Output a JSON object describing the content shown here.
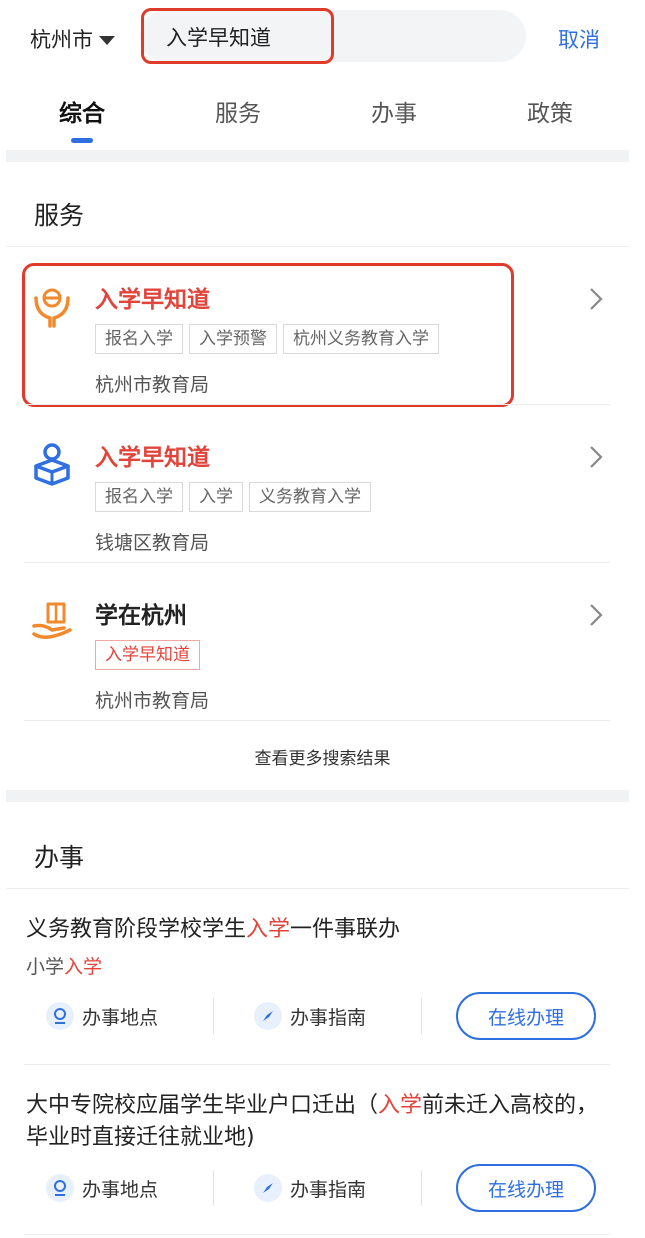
{
  "header": {
    "city": "杭州市",
    "search_query": "入学早知道",
    "cancel": "取消"
  },
  "tabs": [
    {
      "label": "综合",
      "active": true
    },
    {
      "label": "服务",
      "active": false
    },
    {
      "label": "办事",
      "active": false
    },
    {
      "label": "政策",
      "active": false
    }
  ],
  "services": {
    "heading": "服务",
    "items": [
      {
        "title": "入学早知道",
        "tags": [
          "报名入学",
          "入学预警",
          "杭州义务教育入学"
        ],
        "dept": "杭州市教育局"
      },
      {
        "title": "入学早知道",
        "tags": [
          "报名入学",
          "入学",
          "义务教育入学"
        ],
        "dept": "钱塘区教育局"
      },
      {
        "title": "学在杭州",
        "tags": [
          "入学早知道"
        ],
        "dept": "杭州市教育局"
      }
    ],
    "more": "查看更多搜索结果"
  },
  "affairs": {
    "heading": "办事",
    "items": [
      {
        "title_pre": "义务教育阶段学校学生",
        "title_hl": "入学",
        "title_post": "一件事联办",
        "sub_pre": "小学",
        "sub_hl": "入学",
        "location": "办事地点",
        "guide": "办事指南",
        "online": "在线办理"
      },
      {
        "title_pre": "大中专院校应届学生毕业户口迁出（",
        "title_hl": "入学",
        "title_post": "前未迁入高校的，毕业时直接迁往就业地)",
        "location": "办事地点",
        "guide": "办事指南",
        "online": "在线办理"
      }
    ]
  },
  "colors": {
    "accent_blue": "#2f6fe0",
    "highlight_red": "#e0443a",
    "annotation_red": "#e03a2b"
  }
}
